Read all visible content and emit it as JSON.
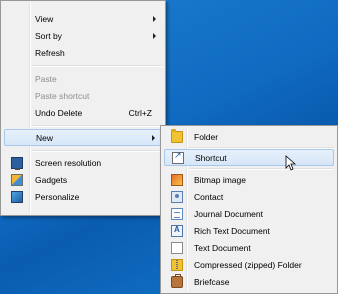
{
  "context_menu": {
    "view_label": "View",
    "sort_by_label": "Sort by",
    "refresh_label": "Refresh",
    "paste_label": "Paste",
    "paste_shortcut_label": "Paste shortcut",
    "undo_delete_label": "Undo Delete",
    "undo_delete_shortcut": "Ctrl+Z",
    "new_label": "New",
    "screen_resolution_label": "Screen resolution",
    "gadgets_label": "Gadgets",
    "personalize_label": "Personalize"
  },
  "new_submenu": {
    "folder_label": "Folder",
    "shortcut_label": "Shortcut",
    "bitmap_label": "Bitmap image",
    "contact_label": "Contact",
    "journal_label": "Journal Document",
    "rtf_label": "Rich Text Document",
    "text_label": "Text Document",
    "zip_label": "Compressed (zipped) Folder",
    "briefcase_label": "Briefcase"
  },
  "icons": {
    "screen_resolution": "monitor-icon",
    "gadgets": "gadgets-icon",
    "personalize": "personalize-icon",
    "folder": "folder-icon",
    "shortcut": "shortcut-icon",
    "bitmap": "bitmap-icon",
    "contact": "contact-icon",
    "journal": "journal-icon",
    "rtf": "rich-text-icon",
    "text": "text-document-icon",
    "zip": "zipped-folder-icon",
    "briefcase": "briefcase-icon"
  },
  "colors": {
    "desktop": "#0f6ac0",
    "menu_bg": "#f0f0f0",
    "highlight": "#d7e6f8",
    "disabled_text": "#8d8d8d"
  }
}
